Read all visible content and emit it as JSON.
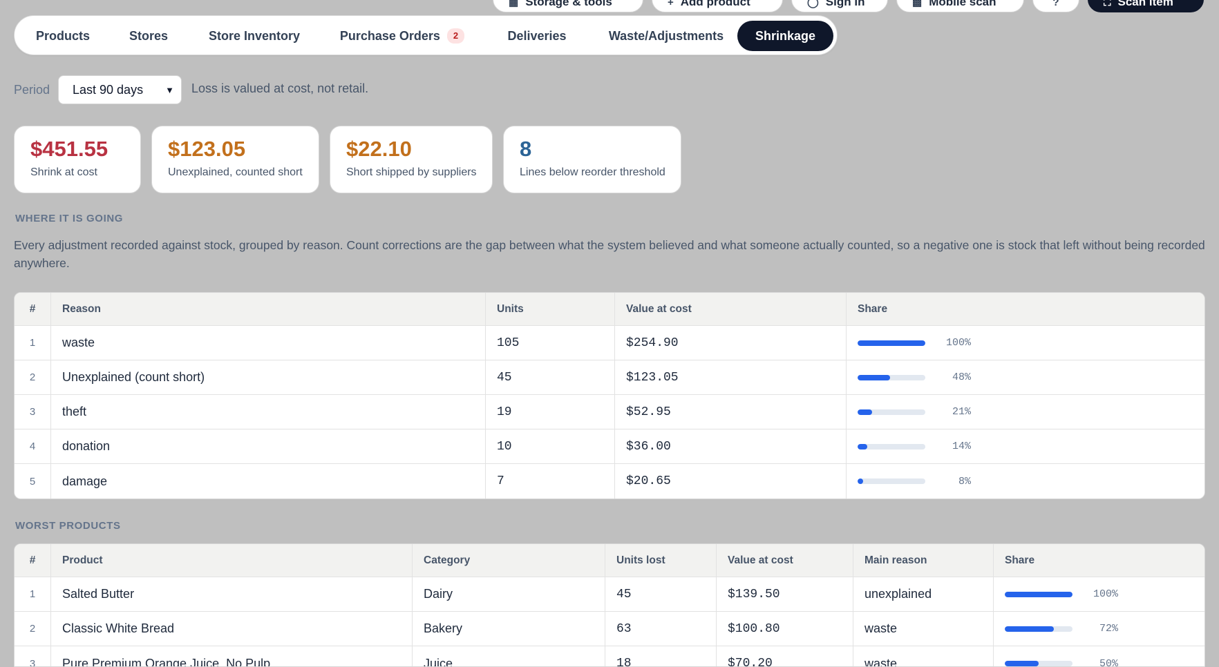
{
  "top_actions": [
    {
      "label": "Storage & tools",
      "icon": "grid-icon"
    },
    {
      "label": "Add product",
      "icon": "plus-icon"
    },
    {
      "label": "Sign in",
      "icon": "user-icon"
    },
    {
      "label": "Mobile scan",
      "icon": "qr-icon"
    },
    {
      "label": "",
      "icon": "help-icon"
    },
    {
      "label": "Scan item",
      "icon": "scan-icon"
    }
  ],
  "tabs": [
    {
      "label": "Products"
    },
    {
      "label": "Stores"
    },
    {
      "label": "Store Inventory"
    },
    {
      "label": "Purchase Orders",
      "badge": "2"
    },
    {
      "label": "Deliveries"
    },
    {
      "label": "Waste/Adjustments"
    },
    {
      "label": "Shrinkage",
      "active": true
    }
  ],
  "filters": {
    "period_label": "Period",
    "period_value": "Last 90 days",
    "note": "Loss is valued at cost, not retail."
  },
  "stats": [
    {
      "value": "$451.55",
      "label": "Shrink at cost",
      "color": "#b83242"
    },
    {
      "value": "$123.05",
      "label": "Unexplained, counted short",
      "color": "#c2701c"
    },
    {
      "value": "$22.10",
      "label": "Short shipped by suppliers",
      "color": "#c2701c"
    },
    {
      "value": "8",
      "label": "Lines below reorder threshold",
      "color": "#2c6496"
    }
  ],
  "reasons_section": {
    "title": "Where it is going",
    "description": "Every adjustment recorded against stock, grouped by reason. Count corrections are the gap between what the system believed and what someone actually counted, so a negative one is stock that left without being recorded anywhere.",
    "columns": [
      "#",
      "Reason",
      "Units",
      "Value at cost",
      "Share"
    ],
    "rows": [
      {
        "n": "1",
        "reason": "waste",
        "units": "105",
        "value": "$254.90",
        "share": 1.0,
        "pct": "100%"
      },
      {
        "n": "2",
        "reason": "Unexplained (count short)",
        "units": "45",
        "value": "$123.05",
        "share": 0.48,
        "pct": "48%"
      },
      {
        "n": "3",
        "reason": "theft",
        "units": "19",
        "value": "$52.95",
        "share": 0.21,
        "pct": "21%"
      },
      {
        "n": "4",
        "reason": "donation",
        "units": "10",
        "value": "$36.00",
        "share": 0.14,
        "pct": "14%"
      },
      {
        "n": "5",
        "reason": "damage",
        "units": "7",
        "value": "$20.65",
        "share": 0.08,
        "pct": "8%"
      }
    ]
  },
  "products_section": {
    "title": "Worst products",
    "columns": [
      "#",
      "Product",
      "Category",
      "Units lost",
      "Value at cost",
      "Main reason",
      "Share"
    ],
    "rows": [
      {
        "n": "1",
        "product": "Salted Butter",
        "category": "Dairy",
        "units": "45",
        "value": "$139.50",
        "reason": "unexplained",
        "share": 1.0,
        "pct": "100%"
      },
      {
        "n": "2",
        "product": "Classic White Bread",
        "category": "Bakery",
        "units": "63",
        "value": "$100.80",
        "reason": "waste",
        "share": 0.72,
        "pct": "72%"
      },
      {
        "n": "3",
        "product": "Pure Premium Orange Juice, No Pulp",
        "category": "Juice",
        "units": "18",
        "value": "$70.20",
        "reason": "waste",
        "share": 0.5,
        "pct": "50%"
      }
    ]
  }
}
